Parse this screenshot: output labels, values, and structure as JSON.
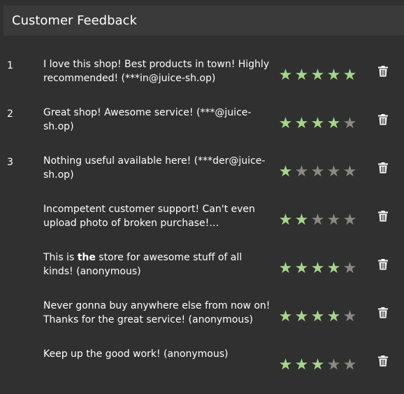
{
  "header": {
    "title": "Customer Feedback"
  },
  "colors": {
    "background": "#303030",
    "header": "#3a3a3a",
    "star_on": "#a5d58b",
    "star_off": "#8a8a82"
  },
  "feedback": [
    {
      "id": "1",
      "comment_before": "I love this shop! Best products in town! Highly recommended! (***in@juice-sh.op)",
      "comment_emph": "",
      "comment_after": "",
      "rating": 5,
      "delete_icon": "trash-icon"
    },
    {
      "id": "2",
      "comment_before": "Great shop! Awesome service! (***@juice-sh.op)",
      "comment_emph": "",
      "comment_after": "",
      "rating": 4,
      "delete_icon": "trash-icon"
    },
    {
      "id": "3",
      "comment_before": "Nothing useful available here! (***der@juice-sh.op)",
      "comment_emph": "",
      "comment_after": "",
      "rating": 1,
      "delete_icon": "trash-icon"
    },
    {
      "id": "",
      "comment_before": "Incompetent customer support! Can't even upload photo of broken purchase!…",
      "comment_emph": "",
      "comment_after": "",
      "rating": 2,
      "delete_icon": "trash-icon"
    },
    {
      "id": "",
      "comment_before": "This is ",
      "comment_emph": "the",
      "comment_after": " store for awesome stuff of all kinds! (anonymous)",
      "rating": 4,
      "delete_icon": "trash-icon"
    },
    {
      "id": "",
      "comment_before": "Never gonna buy anywhere else from now on! Thanks for the great service! (anonymous)",
      "comment_emph": "",
      "comment_after": "",
      "rating": 4,
      "delete_icon": "trash-icon"
    },
    {
      "id": "",
      "comment_before": "Keep up the good work! (anonymous)",
      "comment_emph": "",
      "comment_after": "",
      "rating": 3,
      "delete_icon": "trash-icon"
    }
  ],
  "max_rating": 5
}
